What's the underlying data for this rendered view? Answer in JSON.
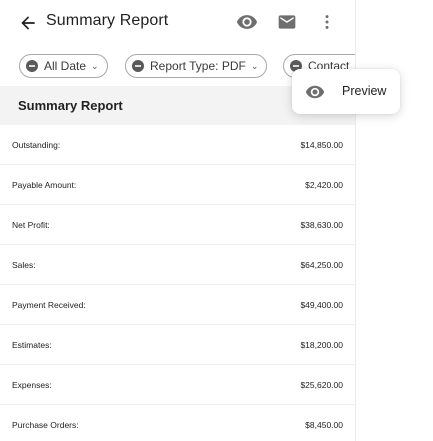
{
  "header": {
    "title": "Summary Report",
    "icons": [
      "back-arrow-icon",
      "eye-icon",
      "mail-icon",
      "more-vert-icon"
    ]
  },
  "filters": {
    "chips": [
      {
        "label": "All Date",
        "icon": "minus-circle-icon",
        "has_dropdown": true
      },
      {
        "label": "Report Type: PDF",
        "icon": "minus-circle-icon",
        "has_dropdown": true
      },
      {
        "label": "Contact",
        "icon": "minus-circle-icon",
        "has_dropdown": false
      }
    ]
  },
  "section": {
    "title": "Summary Report"
  },
  "rows": [
    {
      "label": "Outstanding:",
      "value": "$14,850.00"
    },
    {
      "label": "Payable Amount:",
      "value": "$2,420.00"
    },
    {
      "label": "Net Profit:",
      "value": "$38,630.00"
    },
    {
      "label": "Sales:",
      "value": "$64,250.00"
    },
    {
      "label": "Payment Received:",
      "value": "$49,400.00"
    },
    {
      "label": "Estimates:",
      "value": "$18,200.00"
    },
    {
      "label": "Expenses:",
      "value": "$25,620.00"
    },
    {
      "label": "Purchase Orders:",
      "value": "$8,450.00"
    }
  ],
  "popup_menu": {
    "items": [
      {
        "label": "Preview",
        "icon": "eye-icon"
      }
    ]
  },
  "colors": {
    "icon_gray": "#6e6e6e",
    "section_bg": "#f3f3f3",
    "chip_border": "#a8a8a8",
    "text": "#222222"
  }
}
